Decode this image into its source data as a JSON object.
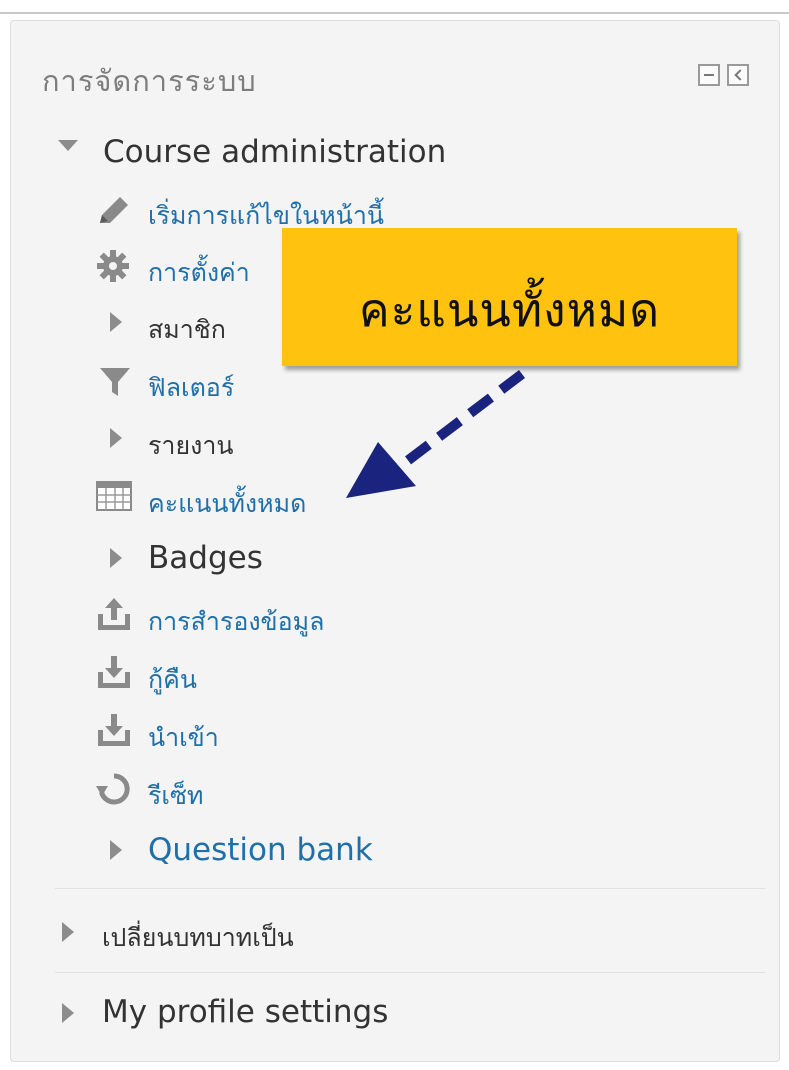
{
  "block": {
    "title": "การจัดการระบบ",
    "collapse_icon": "minus-box-icon",
    "dock_icon": "dock-left-icon"
  },
  "course_admin": {
    "label": "Course administration",
    "items": [
      {
        "label": "เริ่มการแก้ไขในหน้านี้",
        "icon": "pencil-icon"
      },
      {
        "label": "การตั้งค่า",
        "icon": "gear-icon"
      },
      {
        "label": "สมาชิก",
        "icon": "expand-arrow-icon"
      },
      {
        "label": "ฟิลเตอร์",
        "icon": "filter-icon"
      },
      {
        "label": "รายงาน",
        "icon": "expand-arrow-icon"
      },
      {
        "label": "คะแนนทั้งหมด",
        "icon": "table-icon"
      },
      {
        "label": "Badges",
        "icon": "expand-arrow-icon"
      },
      {
        "label": "การสำรองข้อมูล",
        "icon": "upload-icon"
      },
      {
        "label": "กู้คืน",
        "icon": "download-icon"
      },
      {
        "label": "นำเข้า",
        "icon": "download-icon"
      },
      {
        "label": "รีเซ็ท",
        "icon": "reset-icon"
      },
      {
        "label": "Question bank",
        "icon": "expand-arrow-icon"
      }
    ]
  },
  "switch_role": {
    "label": "เปลี่ยนบทบาทเป็น"
  },
  "profile": {
    "label": "My profile settings"
  },
  "callout": {
    "text": "คะแนนทั้งหมด"
  },
  "colors": {
    "link": "#1f6fa8",
    "callout": "#ffc20e",
    "arrow": "#1a237e"
  }
}
